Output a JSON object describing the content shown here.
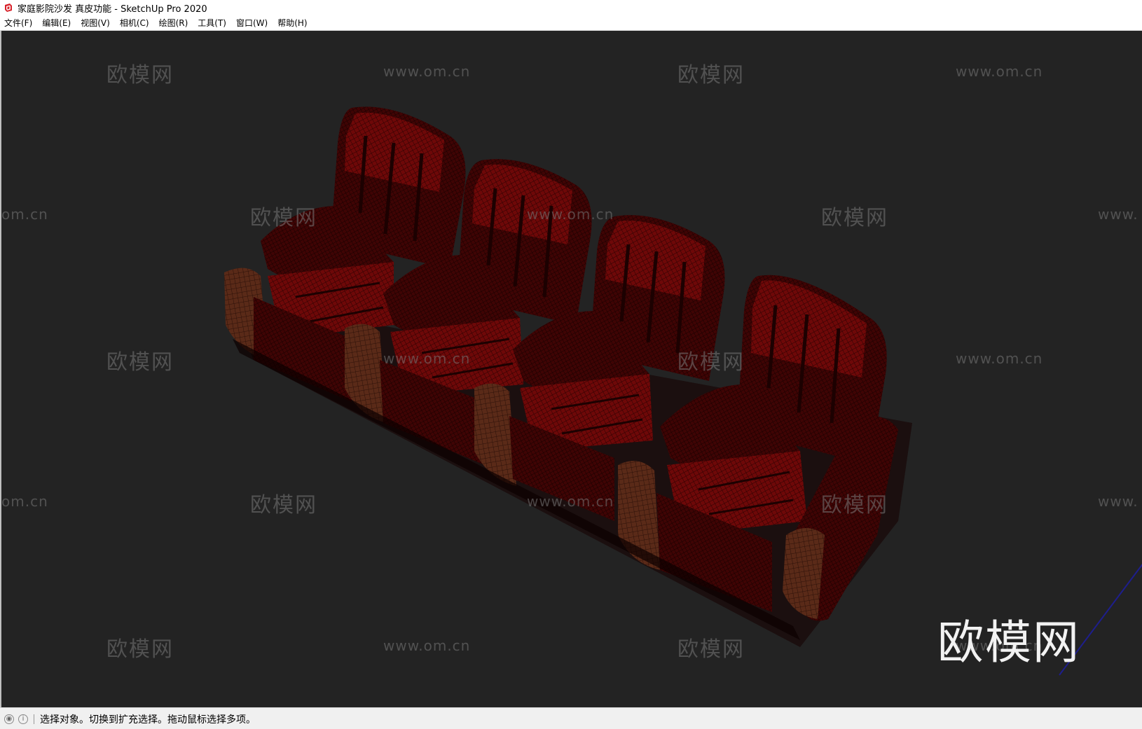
{
  "window": {
    "title": "家庭影院沙发 真皮功能 - SketchUp Pro 2020"
  },
  "menu": {
    "items": [
      {
        "label": "文件(F)"
      },
      {
        "label": "编辑(E)"
      },
      {
        "label": "视图(V)"
      },
      {
        "label": "相机(C)"
      },
      {
        "label": "绘图(R)"
      },
      {
        "label": "工具(T)"
      },
      {
        "label": "窗口(W)"
      },
      {
        "label": "帮助(H)"
      }
    ]
  },
  "viewport": {
    "background_color": "#232323",
    "model_color": "#7a0a0a",
    "watermark_text_cn": "欧模网",
    "watermark_text_url": "www.om.cn",
    "watermark_partial_url_left": "om.cn",
    "watermark_partial_url_right": "www.",
    "big_watermark": "欧模网"
  },
  "statusbar": {
    "icons": [
      "geo-location-icon",
      "info-icon"
    ],
    "message": "选择对象。切换到扩充选择。拖动鼠标选择多项。"
  }
}
